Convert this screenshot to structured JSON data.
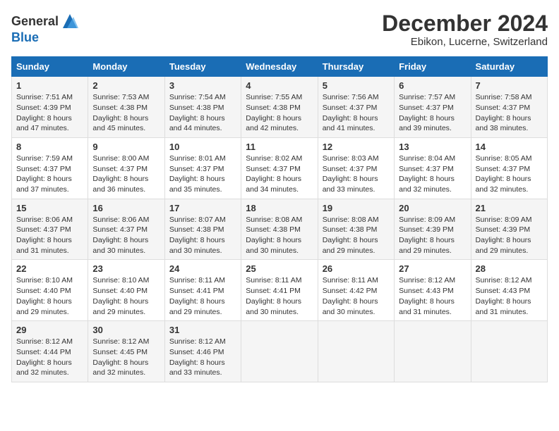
{
  "header": {
    "logo_general": "General",
    "logo_blue": "Blue",
    "month_title": "December 2024",
    "location": "Ebikon, Lucerne, Switzerland"
  },
  "days_of_week": [
    "Sunday",
    "Monday",
    "Tuesday",
    "Wednesday",
    "Thursday",
    "Friday",
    "Saturday"
  ],
  "weeks": [
    [
      {
        "day": "1",
        "sunrise": "7:51 AM",
        "sunset": "4:39 PM",
        "daylight": "8 hours and 47 minutes."
      },
      {
        "day": "2",
        "sunrise": "7:53 AM",
        "sunset": "4:38 PM",
        "daylight": "8 hours and 45 minutes."
      },
      {
        "day": "3",
        "sunrise": "7:54 AM",
        "sunset": "4:38 PM",
        "daylight": "8 hours and 44 minutes."
      },
      {
        "day": "4",
        "sunrise": "7:55 AM",
        "sunset": "4:38 PM",
        "daylight": "8 hours and 42 minutes."
      },
      {
        "day": "5",
        "sunrise": "7:56 AM",
        "sunset": "4:37 PM",
        "daylight": "8 hours and 41 minutes."
      },
      {
        "day": "6",
        "sunrise": "7:57 AM",
        "sunset": "4:37 PM",
        "daylight": "8 hours and 39 minutes."
      },
      {
        "day": "7",
        "sunrise": "7:58 AM",
        "sunset": "4:37 PM",
        "daylight": "8 hours and 38 minutes."
      }
    ],
    [
      {
        "day": "8",
        "sunrise": "7:59 AM",
        "sunset": "4:37 PM",
        "daylight": "8 hours and 37 minutes."
      },
      {
        "day": "9",
        "sunrise": "8:00 AM",
        "sunset": "4:37 PM",
        "daylight": "8 hours and 36 minutes."
      },
      {
        "day": "10",
        "sunrise": "8:01 AM",
        "sunset": "4:37 PM",
        "daylight": "8 hours and 35 minutes."
      },
      {
        "day": "11",
        "sunrise": "8:02 AM",
        "sunset": "4:37 PM",
        "daylight": "8 hours and 34 minutes."
      },
      {
        "day": "12",
        "sunrise": "8:03 AM",
        "sunset": "4:37 PM",
        "daylight": "8 hours and 33 minutes."
      },
      {
        "day": "13",
        "sunrise": "8:04 AM",
        "sunset": "4:37 PM",
        "daylight": "8 hours and 32 minutes."
      },
      {
        "day": "14",
        "sunrise": "8:05 AM",
        "sunset": "4:37 PM",
        "daylight": "8 hours and 32 minutes."
      }
    ],
    [
      {
        "day": "15",
        "sunrise": "8:06 AM",
        "sunset": "4:37 PM",
        "daylight": "8 hours and 31 minutes."
      },
      {
        "day": "16",
        "sunrise": "8:06 AM",
        "sunset": "4:37 PM",
        "daylight": "8 hours and 30 minutes."
      },
      {
        "day": "17",
        "sunrise": "8:07 AM",
        "sunset": "4:38 PM",
        "daylight": "8 hours and 30 minutes."
      },
      {
        "day": "18",
        "sunrise": "8:08 AM",
        "sunset": "4:38 PM",
        "daylight": "8 hours and 30 minutes."
      },
      {
        "day": "19",
        "sunrise": "8:08 AM",
        "sunset": "4:38 PM",
        "daylight": "8 hours and 29 minutes."
      },
      {
        "day": "20",
        "sunrise": "8:09 AM",
        "sunset": "4:39 PM",
        "daylight": "8 hours and 29 minutes."
      },
      {
        "day": "21",
        "sunrise": "8:09 AM",
        "sunset": "4:39 PM",
        "daylight": "8 hours and 29 minutes."
      }
    ],
    [
      {
        "day": "22",
        "sunrise": "8:10 AM",
        "sunset": "4:40 PM",
        "daylight": "8 hours and 29 minutes."
      },
      {
        "day": "23",
        "sunrise": "8:10 AM",
        "sunset": "4:40 PM",
        "daylight": "8 hours and 29 minutes."
      },
      {
        "day": "24",
        "sunrise": "8:11 AM",
        "sunset": "4:41 PM",
        "daylight": "8 hours and 29 minutes."
      },
      {
        "day": "25",
        "sunrise": "8:11 AM",
        "sunset": "4:41 PM",
        "daylight": "8 hours and 30 minutes."
      },
      {
        "day": "26",
        "sunrise": "8:11 AM",
        "sunset": "4:42 PM",
        "daylight": "8 hours and 30 minutes."
      },
      {
        "day": "27",
        "sunrise": "8:12 AM",
        "sunset": "4:43 PM",
        "daylight": "8 hours and 31 minutes."
      },
      {
        "day": "28",
        "sunrise": "8:12 AM",
        "sunset": "4:43 PM",
        "daylight": "8 hours and 31 minutes."
      }
    ],
    [
      {
        "day": "29",
        "sunrise": "8:12 AM",
        "sunset": "4:44 PM",
        "daylight": "8 hours and 32 minutes."
      },
      {
        "day": "30",
        "sunrise": "8:12 AM",
        "sunset": "4:45 PM",
        "daylight": "8 hours and 32 minutes."
      },
      {
        "day": "31",
        "sunrise": "8:12 AM",
        "sunset": "4:46 PM",
        "daylight": "8 hours and 33 minutes."
      },
      {
        "day": "",
        "sunrise": "",
        "sunset": "",
        "daylight": ""
      },
      {
        "day": "",
        "sunrise": "",
        "sunset": "",
        "daylight": ""
      },
      {
        "day": "",
        "sunrise": "",
        "sunset": "",
        "daylight": ""
      },
      {
        "day": "",
        "sunrise": "",
        "sunset": "",
        "daylight": ""
      }
    ]
  ],
  "labels": {
    "sunrise": "Sunrise:",
    "sunset": "Sunset:",
    "daylight": "Daylight:"
  }
}
